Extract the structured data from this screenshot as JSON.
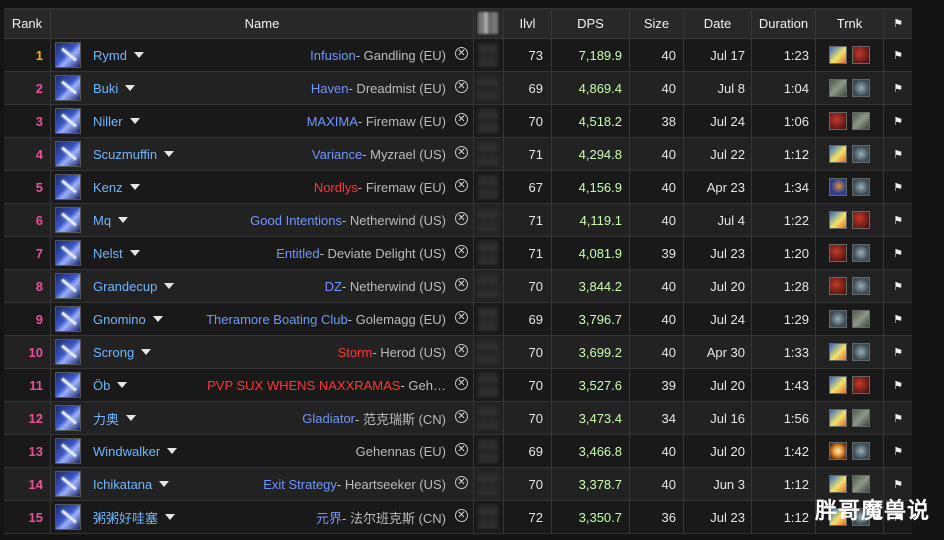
{
  "headers": {
    "rank": "Rank",
    "name": "Name",
    "ilvl": "Ilvl",
    "dps": "DPS",
    "size": "Size",
    "date": "Date",
    "duration": "Duration",
    "trnk": "Trnk",
    "flag_icon": "flag-icon"
  },
  "rows": [
    {
      "rank": "1",
      "player": "Rymd",
      "guild": "Infusion",
      "guild_color": "blue",
      "server": " - Gandling (EU)",
      "ilvl": "73",
      "dps": "7,189.9",
      "size": "40",
      "date": "Jul 17",
      "duration": "1:23",
      "trinkets": [
        "fire",
        "red"
      ]
    },
    {
      "rank": "2",
      "player": "Buki",
      "guild": "Haven",
      "guild_color": "blue",
      "server": " - Dreadmist (EU)",
      "ilvl": "69",
      "dps": "4,869.4",
      "size": "40",
      "date": "Jul 8",
      "duration": "1:04",
      "trinkets": [
        "grey",
        "eye"
      ]
    },
    {
      "rank": "3",
      "player": "Niller",
      "guild": "MAXIMA",
      "guild_color": "blue",
      "server": " - Firemaw (EU)",
      "ilvl": "70",
      "dps": "4,518.2",
      "size": "38",
      "date": "Jul 24",
      "duration": "1:06",
      "trinkets": [
        "red",
        "grey"
      ]
    },
    {
      "rank": "4",
      "player": "Scuzmuffin",
      "guild": "Variance",
      "guild_color": "blue",
      "server": " - Myzrael (US)",
      "ilvl": "71",
      "dps": "4,294.8",
      "size": "40",
      "date": "Jul 22",
      "duration": "1:12",
      "trinkets": [
        "fire",
        "eye"
      ]
    },
    {
      "rank": "5",
      "player": "Kenz",
      "guild": "Nordlys",
      "guild_color": "red",
      "server": " - Firemaw (EU)",
      "ilvl": "67",
      "dps": "4,156.9",
      "size": "40",
      "date": "Apr 23",
      "duration": "1:34",
      "trinkets": [
        "blue",
        "eye"
      ]
    },
    {
      "rank": "6",
      "player": "Mq",
      "guild": "Good Intentions",
      "guild_color": "blue",
      "server": " - Netherwind (US)",
      "ilvl": "71",
      "dps": "4,119.1",
      "size": "40",
      "date": "Jul 4",
      "duration": "1:22",
      "trinkets": [
        "fire",
        "red"
      ]
    },
    {
      "rank": "7",
      "player": "Nelst",
      "guild": "Entitled",
      "guild_color": "blue",
      "server": " - Deviate Delight (US)",
      "ilvl": "71",
      "dps": "4,081.9",
      "size": "39",
      "date": "Jul 23",
      "duration": "1:20",
      "trinkets": [
        "red",
        "eye"
      ]
    },
    {
      "rank": "8",
      "player": "Grandecup",
      "guild": "DZ",
      "guild_color": "blue",
      "server": " - Netherwind (US)",
      "ilvl": "70",
      "dps": "3,844.2",
      "size": "40",
      "date": "Jul 20",
      "duration": "1:28",
      "trinkets": [
        "red",
        "eye"
      ]
    },
    {
      "rank": "9",
      "player": "Gnomino",
      "guild": "Theramore Boating Club",
      "guild_color": "blue",
      "server": " - Golemagg (EU)",
      "ilvl": "69",
      "dps": "3,796.7",
      "size": "40",
      "date": "Jul 24",
      "duration": "1:29",
      "trinkets": [
        "eye",
        "grey"
      ]
    },
    {
      "rank": "10",
      "player": "Scrong",
      "guild": "Storm",
      "guild_color": "red",
      "server": " - Herod (US)",
      "ilvl": "70",
      "dps": "3,699.2",
      "size": "40",
      "date": "Apr 30",
      "duration": "1:33",
      "trinkets": [
        "fire",
        "eye"
      ]
    },
    {
      "rank": "11",
      "player": "Öb",
      "guild": "PVP SUX WHENS NAXXRAMAS",
      "guild_color": "red",
      "server": " - Geh…",
      "ilvl": "70",
      "dps": "3,527.6",
      "size": "39",
      "date": "Jul 20",
      "duration": "1:43",
      "trinkets": [
        "fire",
        "red"
      ]
    },
    {
      "rank": "12",
      "player": "力奥",
      "guild": "Gladiator",
      "guild_color": "blue",
      "server": " - 范克瑞斯 (CN)",
      "ilvl": "70",
      "dps": "3,473.4",
      "size": "34",
      "date": "Jul 16",
      "duration": "1:56",
      "trinkets": [
        "fire",
        "grey"
      ]
    },
    {
      "rank": "13",
      "player": "Windwalker",
      "guild": "",
      "guild_color": "blue",
      "server": "Gehennas (EU)",
      "ilvl": "69",
      "dps": "3,466.8",
      "size": "40",
      "date": "Jul 20",
      "duration": "1:42",
      "trinkets": [
        "star",
        "eye"
      ]
    },
    {
      "rank": "14",
      "player": "Ichikatana",
      "guild": "Exit Strategy",
      "guild_color": "blue",
      "server": " - Heartseeker (US)",
      "ilvl": "70",
      "dps": "3,378.7",
      "size": "40",
      "date": "Jun 3",
      "duration": "1:12",
      "trinkets": [
        "fire",
        "grey"
      ]
    },
    {
      "rank": "15",
      "player": "粥粥好哇塞",
      "guild": "元界",
      "guild_color": "blue",
      "server": " - 法尔班克斯 (CN)",
      "ilvl": "72",
      "dps": "3,350.7",
      "size": "36",
      "date": "Jul 23",
      "duration": "1:12",
      "trinkets": [
        "fire",
        "eye"
      ]
    }
  ],
  "colors": {
    "rank_top": "#f0b400",
    "rank_other": "#e8509a",
    "player": "#6db6ff",
    "guild_blue": "#6e96ff",
    "guild_red": "#ff3434"
  },
  "watermark": "胖哥魔兽说"
}
